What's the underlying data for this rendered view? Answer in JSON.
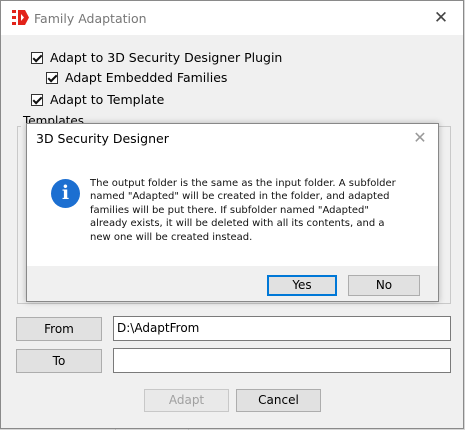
{
  "window": {
    "title": "Family Adaptation",
    "close_glyph": "✕"
  },
  "options": {
    "adapt_plugin": {
      "label": "Adapt to 3D Security Designer Plugin",
      "checked": true
    },
    "adapt_embedded": {
      "label": "Adapt Embedded Families",
      "checked": true
    },
    "adapt_template": {
      "label": "Adapt to Template",
      "checked": true
    }
  },
  "templates": {
    "label": "Templates"
  },
  "from": {
    "button_label": "From",
    "value": "D:\\AdaptFrom"
  },
  "to": {
    "button_label": "To",
    "value": ""
  },
  "footer": {
    "adapt_label": "Adapt",
    "cancel_label": "Cancel"
  },
  "dialog": {
    "title": "3D Security Designer",
    "close_glyph": "✕",
    "icon_glyph": "i",
    "message": "The output folder is the same as the input folder. A subfolder named \"Adapted\" will be created in the folder, and adapted families will be put there. If subfolder named \"Adapted\" already exists, it will be deleted with all its contents, and a new one will be created instead.",
    "yes_label": "Yes",
    "no_label": "No"
  },
  "colors": {
    "accent": "#0078d7",
    "info_icon": "#1c6fd1",
    "logo_red": "#e2231a"
  }
}
